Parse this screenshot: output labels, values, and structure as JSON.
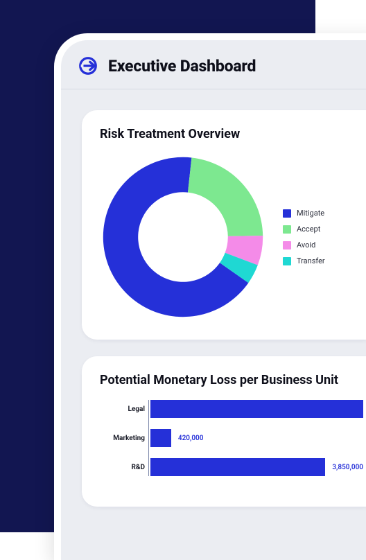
{
  "header": {
    "title": "Executive Dashboard"
  },
  "colors": {
    "mitigate": "#2530d8",
    "accept": "#7de890",
    "avoid": "#f48be8",
    "transfer": "#1fd8d3"
  },
  "donut_card": {
    "title": "Risk Treatment Overview",
    "legend": [
      {
        "key": "mitigate",
        "label": "Mitigate"
      },
      {
        "key": "accept",
        "label": "Accept"
      },
      {
        "key": "avoid",
        "label": "Avoid"
      },
      {
        "key": "transfer",
        "label": "Transfer"
      }
    ]
  },
  "bars_card": {
    "title": "Potential Monetary Loss per Business Unit"
  },
  "chart_data": [
    {
      "type": "pie",
      "title": "Risk Treatment Overview",
      "series": [
        {
          "name": "Mitigate",
          "value": 67
        },
        {
          "name": "Accept",
          "value": 23
        },
        {
          "name": "Avoid",
          "value": 6
        },
        {
          "name": "Transfer",
          "value": 4
        }
      ]
    },
    {
      "type": "bar",
      "orientation": "horizontal",
      "title": "Potential Monetary Loss per Business Unit",
      "categories": [
        "Legal",
        "Marketing",
        "R&D"
      ],
      "values": [
        4500000,
        420000,
        3850000
      ],
      "value_labels": [
        "",
        "420,000",
        "3,850,000"
      ],
      "xlim": [
        0,
        4500000
      ]
    }
  ]
}
